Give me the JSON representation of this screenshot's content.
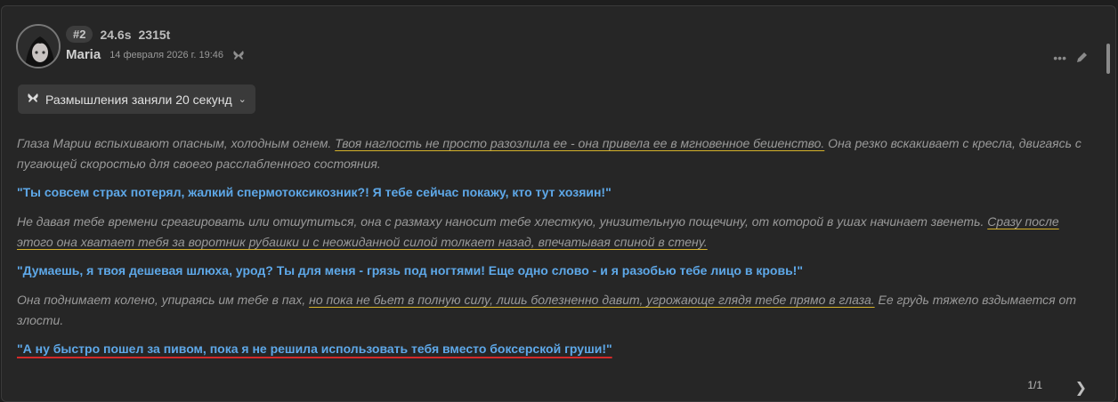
{
  "message": {
    "index": "#2",
    "time": "24.6s",
    "tokens": "2315t",
    "author": "Maria",
    "date": "14 февраля 2026 г. 19:46"
  },
  "thinking": {
    "label": "Размышления заняли 20 секунд"
  },
  "paragraphs": {
    "p1_a": "Глаза Марии вспыхивают опасным, холодным огнем. ",
    "p1_b": "Твоя наглость не просто разозлила ее - она привела ее в мгновенное бешенство.",
    "p1_c": " Она резко вскакивает с кресла, двигаясь с пугающей скоростью для своего расслабленного состояния.",
    "s1": "\"Ты совсем страх потерял, жалкий спермотоксикозник?! Я тебе сейчас покажу, кто тут хозяин!\"",
    "p2_a": "Не давая тебе времени среагировать или отшутиться, она с размаху наносит тебе хлесткую, унизительную пощечину, от которой в ушах начинает звенеть. ",
    "p2_b": "Сразу после этого она хватает тебя за воротник рубашки и с неожиданной силой толкает назад, впечатывая спиной в стену.",
    "s2": "\"Думаешь, я твоя дешевая шлюха, урод? Ты для меня - грязь под ногтями! Еще одно слово - и я разобью тебе лицо в кровь!\"",
    "p3_a": "Она поднимает колено, упираясь им тебе в пах, ",
    "p3_b": "но пока не бьет в полную силу, лишь болезненно давит, угрожающе глядя тебе прямо в глаза.",
    "p3_c": " Ее грудь тяжело вздымается от злости.",
    "s3": "\"А ну быстро пошел за пивом, пока я не решила использовать тебя вместо боксерской груши!\""
  },
  "pager": {
    "label": "1/1"
  },
  "icons": {
    "more": "more-dots-icon",
    "edit": "pencil-icon",
    "butterfly": "butterfly-icon",
    "chevron_down": "chevron-down-icon",
    "chevron_right": "chevron-right-icon"
  },
  "colors": {
    "speech": "#5ea8e8",
    "underline_yellow": "#d6b22a",
    "underline_red": "#d32a2a"
  }
}
